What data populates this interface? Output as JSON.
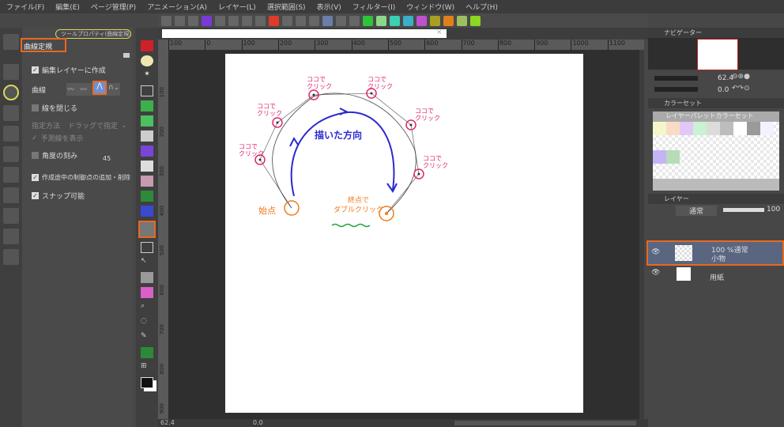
{
  "menu": [
    "ファイル(F)",
    "編集(E)",
    "ページ管理(P)",
    "アニメーション(A)",
    "レイヤー(L)",
    "選択範囲(S)",
    "表示(V)",
    "フィルター(I)",
    "ウィンドウ(W)",
    "ヘルプ(H)"
  ],
  "tool_property": {
    "tab_label": "ツールプロパティ(曲線定規)",
    "subtool_name": "曲線定規",
    "create_on_edit_layer": "編集レイヤーに作成",
    "curve_label": "曲線",
    "close_line": "線を閉じる",
    "spec_method_label": "指定方法",
    "spec_method_value": "ドラッグで指定",
    "show_preview": "予測線を表示",
    "angle_step": "角度の刻み",
    "angle_value": "45",
    "add_delete_points": "作成途中の制御点の追加・削除",
    "snap": "スナップ可能"
  },
  "ruler": [
    "100",
    "0",
    "100",
    "200",
    "300",
    "400",
    "500",
    "600",
    "700",
    "800",
    "900",
    "1000",
    "1100"
  ],
  "vruler": [
    "100",
    "200",
    "300",
    "400",
    "500",
    "600",
    "700",
    "800",
    "900"
  ],
  "navigator": {
    "tab": "ナビゲーター",
    "zoom": "62.4",
    "rotation": "0.0"
  },
  "colorset": {
    "tab": "カラーセット",
    "set_name": "レイヤーパレットカラーセット",
    "swatches": [
      "#f7f5cc",
      "#f9dcc4",
      "#e3c8f7",
      "#c9f2d2",
      "#dcdcdc",
      "#bdbdbd",
      "#ffffff",
      "#9a9a9a",
      "#f4f2ff",
      "#c4b3f7",
      "#b6dcb8"
    ]
  },
  "layers": {
    "tab": "レイヤー",
    "blend": "通常",
    "opacity": "100",
    "items": [
      {
        "info": "100 %通常",
        "name": "小物"
      },
      {
        "name": "用紙"
      }
    ]
  },
  "status": {
    "zoom": "62.4",
    "angle": "0.0"
  },
  "annotations": {
    "click": [
      "ココで",
      "クリック"
    ],
    "direction": "描いた方向",
    "start": "始点",
    "end": [
      "終点で",
      "ダブルクリック"
    ]
  },
  "colors": {
    "accent": "#e8691e",
    "click_label": "#e0266e",
    "arrow": "#2a2ad0",
    "start_end": "#f07a1a"
  }
}
